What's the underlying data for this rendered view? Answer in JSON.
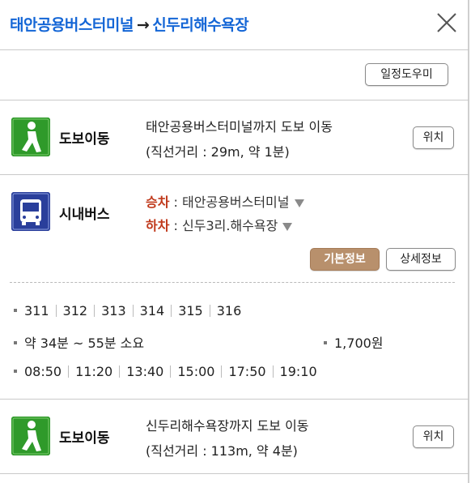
{
  "header": {
    "origin": "태안공용버스터미널",
    "arrow": "→",
    "destination": "신두리해수욕장"
  },
  "toolbar": {
    "schedule_help": "일정도우미"
  },
  "walk1": {
    "mode": "도보이동",
    "line1": "태안공용버스터미널까지 도보 이동",
    "line2": "(직선거리 : 29m, 약 1분)",
    "location_btn": "위치"
  },
  "bus": {
    "mode": "시내버스",
    "board_label": "승차",
    "board_stop": "태안공용버스터미널",
    "alight_label": "하차",
    "alight_stop": "신두3리.해수욕장",
    "sep": " : ",
    "basic_btn": "기본정보",
    "detail_btn": "상세정보",
    "routes": [
      "311",
      "312",
      "313",
      "314",
      "315",
      "316"
    ],
    "duration": "약 34분 ~ 55분 소요",
    "fare": "1,700원",
    "times": [
      "08:50",
      "11:20",
      "13:40",
      "15:00",
      "17:50",
      "19:10"
    ]
  },
  "walk2": {
    "mode": "도보이동",
    "line1": "신두리해수욕장까지 도보 이동",
    "line2": "(직선거리 : 113m, 약 4분)",
    "location_btn": "위치"
  },
  "colors": {
    "title_blue": "#1466d6",
    "walk_green": "#2f9a2a",
    "bus_blue": "#2a3f9b",
    "label_red": "#c0391b",
    "basic_btn_brown": "#b8906c"
  },
  "icons": {
    "close": "close-icon",
    "walk": "walking-person-icon",
    "bus": "bus-icon",
    "dropdown": "triangle-down-icon"
  }
}
